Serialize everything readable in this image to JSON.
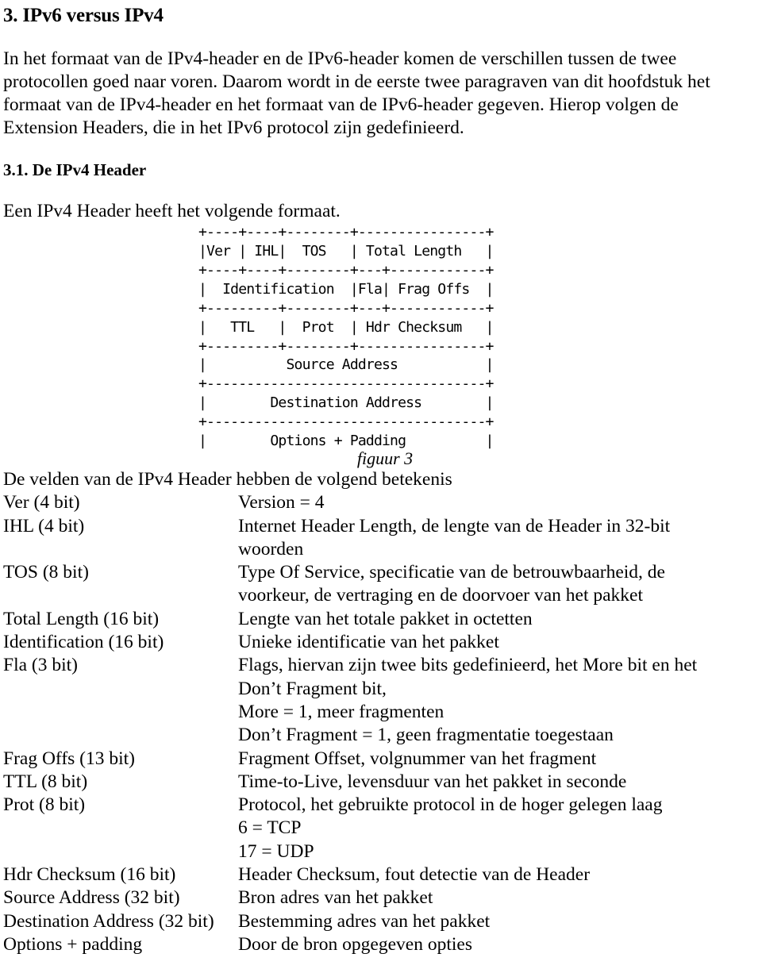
{
  "document": {
    "heading": "3. IPv6 versus IPv4",
    "intro_paragraph": "In het formaat van de IPv4-header en de IPv6-header komen de verschillen tussen de twee protocollen goed naar voren. Daarom wordt in de eerste twee paragraven van dit hoofdstuk het formaat van de IPv4-header en het formaat van de IPv6-header gegeven. Hierop volgen de Extension Headers, die in het IPv6 protocol zijn gedefinieerd.",
    "subheading": "3.1. De IPv4 Header",
    "figure_intro": "Een IPv4 Header heeft het volgende formaat.",
    "figure_caption": "figuur 3",
    "figure_ascii": "+----+----+--------+----------------+\n|Ver | IHL|  TOS   | Total Length   |\n+----+----+--------+---+------------+\n|  Identification  |Fla| Frag Offs  |\n+---------+--------+---+------------+\n|   TTL   |  Prot  | Hdr Checksum   |\n+---------+--------+----------------+\n|          Source Address           |\n+-----------------------------------+\n|        Destination Address        |\n+-----------------------------------+\n|        Options + Padding          |",
    "fields_intro": "De velden van de IPv4 Header hebben de volgend betekenis",
    "fields": [
      {
        "term": "Ver (4 bit)",
        "lines": [
          "Version = 4"
        ]
      },
      {
        "term": "IHL (4 bit)",
        "lines": [
          "Internet Header Length, de lengte van de Header in 32-bit",
          "woorden"
        ]
      },
      {
        "term": "TOS (8 bit)",
        "lines": [
          "Type Of Service, specificatie van de betrouwbaarheid, de",
          "voorkeur, de vertraging en de doorvoer van het pakket"
        ]
      },
      {
        "term": "Total Length (16 bit)",
        "lines": [
          "Lengte van het totale pakket in octetten"
        ]
      },
      {
        "term": "Identification (16 bit)",
        "lines": [
          "Unieke identificatie van het pakket"
        ]
      },
      {
        "term": "Fla (3 bit)",
        "lines": [
          "Flags, hiervan zijn twee bits gedefinieerd, het More bit en het",
          "Don’t Fragment bit,",
          "More = 1, meer fragmenten",
          "Don’t Fragment = 1, geen fragmentatie toegestaan"
        ]
      },
      {
        "term": "Frag Offs (13 bit)",
        "lines": [
          "Fragment Offset, volgnummer van het fragment"
        ]
      },
      {
        "term": "TTL (8 bit)",
        "lines": [
          "Time-to-Live, levensduur van het pakket in seconde"
        ]
      },
      {
        "term": "Prot (8 bit)",
        "lines": [
          "Protocol, het gebruikte protocol in de hoger gelegen laag",
          "6 = TCP",
          "17 = UDP"
        ]
      },
      {
        "term": "Hdr Checksum (16 bit)",
        "lines": [
          "Header Checksum, fout detectie van de Header"
        ]
      },
      {
        "term": "Source Address (32 bit)",
        "lines": [
          "Bron adres van het pakket"
        ]
      },
      {
        "term": "Destination Address (32 bit)",
        "lines": [
          "Bestemming adres van het pakket"
        ]
      },
      {
        "term": "Options + padding",
        "lines": [
          "Door de bron opgegeven opties"
        ]
      }
    ]
  }
}
